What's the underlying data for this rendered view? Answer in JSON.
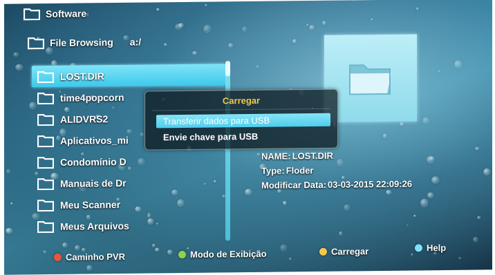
{
  "header": {
    "title": "Software"
  },
  "browser": {
    "path_label": "File Browsing",
    "path_value": "a:/"
  },
  "files": [
    {
      "name": "LOST.DIR",
      "selected": true
    },
    {
      "name": "time4popcorn",
      "selected": false
    },
    {
      "name": "ALIDVRS2",
      "selected": false
    },
    {
      "name": "Aplicativos_mi",
      "selected": false
    },
    {
      "name": "Condomínio D",
      "selected": false
    },
    {
      "name": "Manuais de Dr",
      "selected": false
    },
    {
      "name": "Meu Scanner",
      "selected": false
    },
    {
      "name": "Meus Arquivos",
      "selected": false
    }
  ],
  "info": {
    "name_label": "NAME:",
    "name_value": "LOST.DIR",
    "type_label": "Type:",
    "type_value": "Floder",
    "date_label": "Modificar Data:",
    "date_value": "03-03-2015 22:09:26"
  },
  "dialog": {
    "title": "Carregar",
    "options": [
      "Transferir dados para USB",
      "Envie chave para USB"
    ]
  },
  "footer": {
    "items": [
      {
        "label": "Caminho PVR",
        "color": "#e8553c"
      },
      {
        "label": "Modo de Exibição",
        "color": "#8fd34a"
      },
      {
        "label": "Carregar",
        "color": "#f2c94c"
      },
      {
        "label": "Help",
        "color": "#7fe0f5"
      }
    ]
  },
  "colors": {
    "highlight": "#4fcdec",
    "dialog_title": "#f2c94c"
  },
  "icons": {
    "folder": "folder-icon"
  }
}
